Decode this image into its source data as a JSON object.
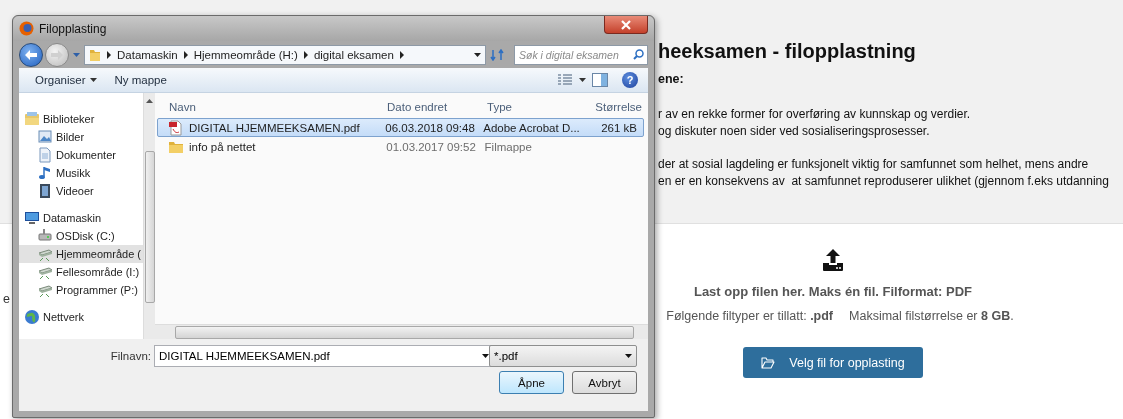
{
  "page": {
    "heading": "heeksamen - filopplastning",
    "subheading": "ene:",
    "paragraphs": [
      [
        "r av en rekke former for overføring av kunnskap og verdier.",
        "og diskuter noen sider ved sosialiseringsprosesser."
      ],
      [
        "der at sosial lagdeling er funksjonelt viktig for samfunnet som helhet, mens andre",
        "en er en konsekvens av  at samfunnet reproduserer ulikhet (gjennom f.eks utdanning"
      ]
    ],
    "left_fragment": "e",
    "upload": {
      "instruction": "Last opp filen her. Maks én fil. Filformat: PDF",
      "limits": [
        "Følgende filtyper er tillatt: **.pdf**",
        "Maksimal filstørrelse er **8 GB**."
      ],
      "button": "Velg fil for opplasting"
    }
  },
  "dialog": {
    "title": "Filopplasting",
    "path": [
      "Datamaskin",
      "Hjemmeområde (H:)",
      "digital eksamen"
    ],
    "search": {
      "placeholder": "Søk i digital eksamen"
    },
    "toolbar": {
      "organize": "Organiser",
      "new_folder": "Ny mappe",
      "help": "?"
    },
    "nav": [
      {
        "label": "Biblioteker",
        "kind": "library",
        "selected": false,
        "children": [
          {
            "label": "Bilder",
            "kind": "pictures",
            "selected": false
          },
          {
            "label": "Dokumenter",
            "kind": "documents",
            "selected": false
          },
          {
            "label": "Musikk",
            "kind": "music",
            "selected": false
          },
          {
            "label": "Videoer",
            "kind": "videos",
            "selected": false
          }
        ]
      },
      {
        "label": "Datamaskin",
        "kind": "computer",
        "selected": false,
        "children": [
          {
            "label": "OSDisk (C:)",
            "kind": "disk",
            "selected": false
          },
          {
            "label": "Hjemmeområde (",
            "kind": "network-drive",
            "selected": true
          },
          {
            "label": "Fellesområde (I:)",
            "kind": "network-drive",
            "selected": false
          },
          {
            "label": "Programmer (P:)",
            "kind": "network-drive",
            "selected": false
          }
        ]
      },
      {
        "label": "Nettverk",
        "kind": "network",
        "selected": false
      }
    ],
    "columns": [
      "Navn",
      "Dato endret",
      "Type",
      "Størrelse"
    ],
    "files": [
      {
        "kind": "pdf",
        "name": "DIGITAL HJEMMEEKSAMEN.pdf",
        "modified": "06.03.2018 09:48",
        "type": "Adobe Acrobat D...",
        "size": "261 kB",
        "selected": true
      },
      {
        "kind": "folder",
        "name": "info på nettet",
        "modified": "01.03.2017 09:52",
        "type": "Filmappe",
        "selected": false
      }
    ],
    "file_name_label": "Filnavn:",
    "file_name": "DIGITAL HJEMMEEKSAMEN.pdf",
    "file_type": "*.pdf",
    "buttons": [
      {
        "label": "Åpne",
        "default": true
      },
      {
        "label": "Avbryt",
        "default": false
      }
    ]
  }
}
